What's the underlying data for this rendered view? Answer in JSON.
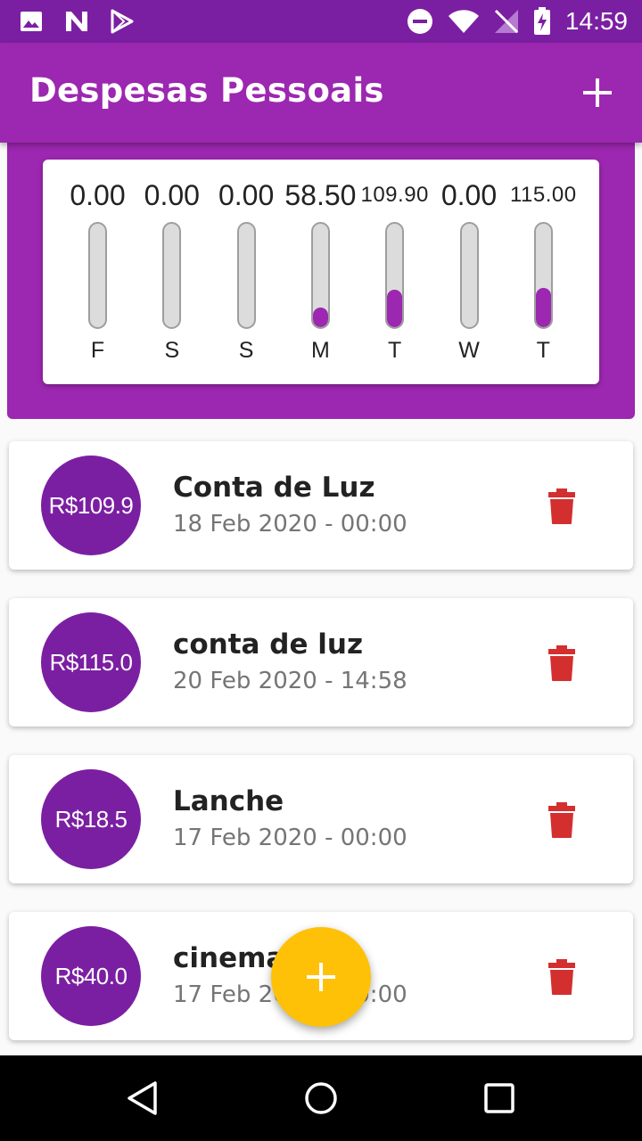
{
  "status_bar": {
    "time": "14:59",
    "left_icons": [
      "image-icon",
      "n-notification-icon",
      "play-store-icon"
    ],
    "right_icons": [
      "do-not-disturb-icon",
      "wifi-icon",
      "no-signal-icon",
      "battery-charging-icon"
    ]
  },
  "app_bar": {
    "title": "Despesas Pessoais",
    "add_icon": "plus-icon"
  },
  "chart_data": {
    "type": "bar",
    "categories": [
      "F",
      "S",
      "S",
      "M",
      "T",
      "W",
      "T"
    ],
    "values": [
      0.0,
      0.0,
      0.0,
      58.5,
      109.9,
      0.0,
      115.0
    ],
    "labels": [
      "0.00",
      "0.00",
      "0.00",
      "58.50",
      "109.90",
      "0.00",
      "115.00"
    ],
    "fractions": [
      0,
      0,
      0,
      0.19,
      0.36,
      0,
      0.38
    ],
    "bar_color": "#9c27b0",
    "track_color": "#dcdcdc"
  },
  "expenses": [
    {
      "amount": "R$109.9",
      "title": "Conta de Luz",
      "date": "18 Feb 2020 - 00:00"
    },
    {
      "amount": "R$115.0",
      "title": "conta de luz",
      "date": "20 Feb 2020 - 14:58"
    },
    {
      "amount": "R$18.5",
      "title": "Lanche",
      "date": "17 Feb 2020 - 00:00"
    },
    {
      "amount": "R$40.0",
      "title": "cinema",
      "date": "17 Feb 2020 - 00:00"
    }
  ],
  "colors": {
    "primary": "#9c27b0",
    "primary_dark": "#7b1fa2",
    "accent": "#ffc107",
    "delete": "#d32f2f"
  },
  "fab": {
    "icon": "plus-icon"
  },
  "nav_bar": {
    "buttons": [
      "back-icon",
      "home-icon",
      "recents-icon"
    ]
  }
}
